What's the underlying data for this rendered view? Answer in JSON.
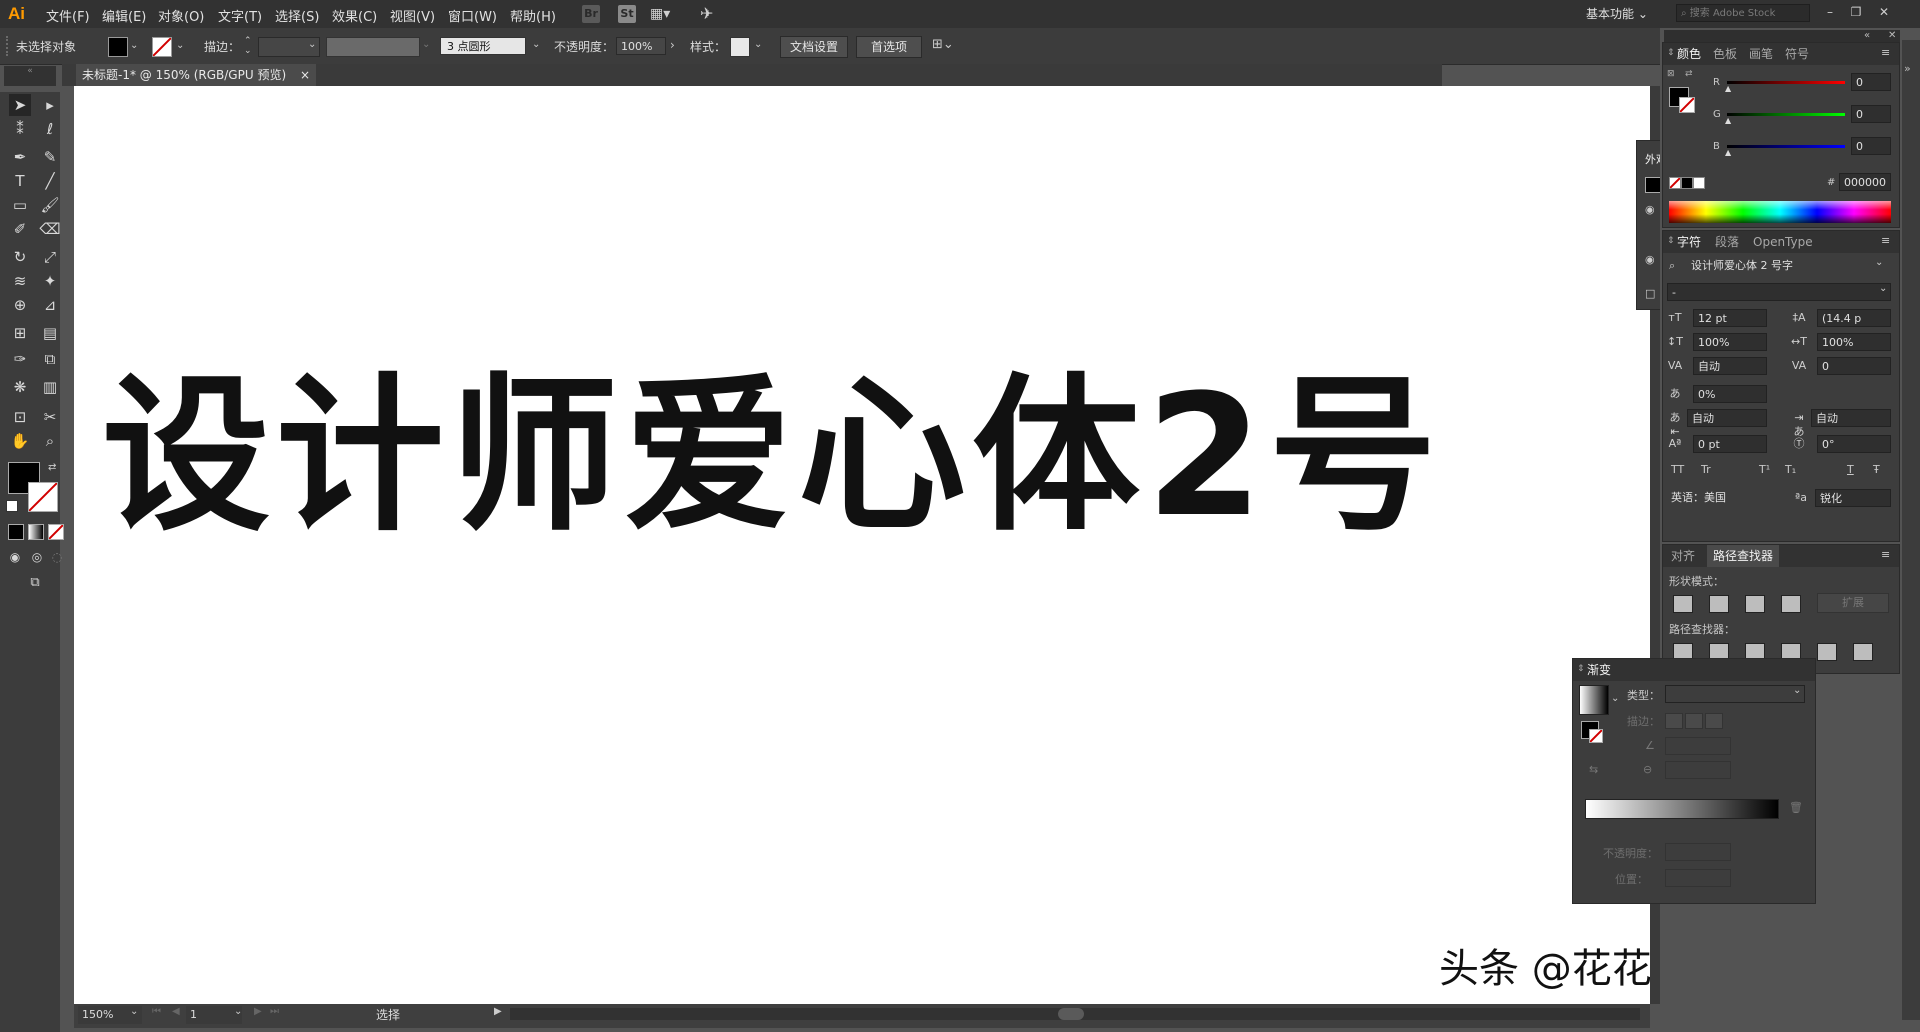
{
  "app": {
    "logo": "Ai",
    "workspace": "基本功能",
    "search_placeholder": "搜索 Adobe Stock"
  },
  "menu": [
    "文件(F)",
    "编辑(E)",
    "对象(O)",
    "文字(T)",
    "选择(S)",
    "效果(C)",
    "视图(V)",
    "窗口(W)",
    "帮助(H)"
  ],
  "menubar_icons": {
    "br": "Br",
    "st": "St"
  },
  "control": {
    "no_selection": "未选择对象",
    "stroke_label": "描边：",
    "brush_value": "3 点圆形",
    "opacity_label": "不透明度：",
    "opacity_value": "100%",
    "style_label": "样式：",
    "doc_setup": "文档设置",
    "preferences": "首选项"
  },
  "document": {
    "tab_title": "未标题-1* @ 150% (RGB/GPU 预览)",
    "artwork_text": "设计师爱心体2号"
  },
  "status": {
    "zoom": "150%",
    "page": "1",
    "mode": "选择"
  },
  "color_panel": {
    "tabs": [
      "颜色",
      "色板",
      "画笔",
      "符号"
    ],
    "r_label": "R",
    "g_label": "G",
    "b_label": "B",
    "r": "0",
    "g": "0",
    "b": "0",
    "hash": "#",
    "hex": "000000"
  },
  "character_panel": {
    "tabs": [
      "字符",
      "段落",
      "OpenType"
    ],
    "font": "设计师爱心体 2 号字",
    "style": "-",
    "size": "12 pt",
    "leading": "(14.4 p",
    "vscale": "100%",
    "hscale": "100%",
    "kerning": "自动",
    "tracking": "0",
    "tsume": "0%",
    "aki_left": "自动",
    "aki_right": "自动",
    "baseline": "0 pt",
    "rotation": "0°",
    "language": "英语：美国",
    "aa": "锐化",
    "case_buttons": [
      "TT",
      "Tr",
      "T¹",
      "T₁",
      "T",
      "Ŧ"
    ]
  },
  "pathfinder_panel": {
    "tabs": [
      "对齐",
      "路径查找器"
    ],
    "shape_modes": "形状模式：",
    "pathfinders": "路径查找器：",
    "expand": "扩展"
  },
  "gradient_panel": {
    "title": "渐变",
    "type_label": "类型：",
    "stroke_label": "描边：",
    "opacity_label": "不透明度：",
    "position_label": "位置："
  },
  "floating_panel": {
    "title": "外观"
  },
  "watermark": "头条 @花花平面设计"
}
